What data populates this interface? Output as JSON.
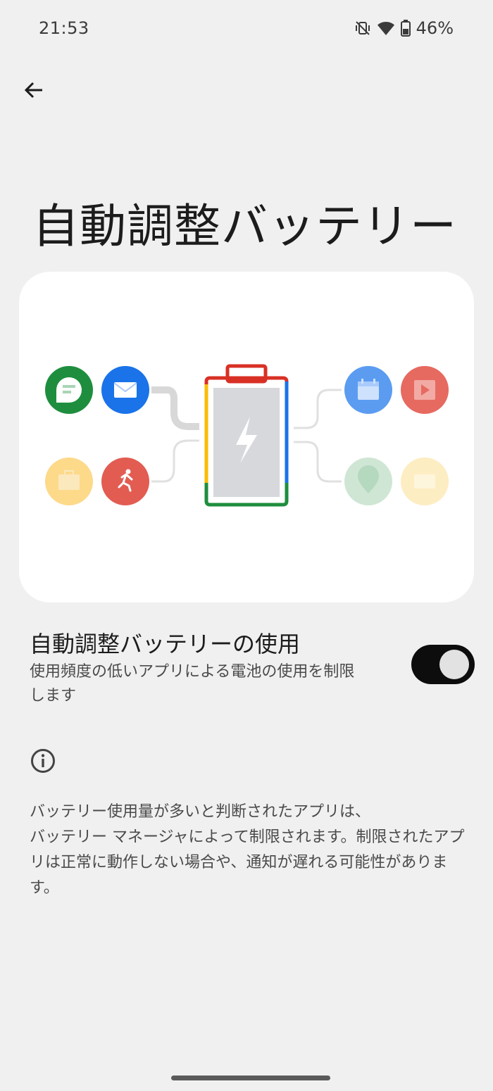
{
  "status_bar": {
    "time": "21:53",
    "battery_percent": "46%",
    "icons": [
      "vibrate-off-icon",
      "wifi-icon",
      "battery-icon"
    ]
  },
  "header": {
    "back_icon": "arrow-back-icon"
  },
  "page": {
    "title": "自動調整バッテリー"
  },
  "illustration": {
    "left_apps": [
      "message-icon",
      "mail-icon",
      "briefcase-icon",
      "running-icon"
    ],
    "right_apps": [
      "calendar-icon",
      "video-icon",
      "map-pin-icon",
      "card-icon"
    ],
    "center": "battery-charging-icon",
    "colors": {
      "green": "#1e8e3e",
      "blue": "#1a73e8",
      "yellow": "#fbbc04",
      "red": "#d93025"
    }
  },
  "setting": {
    "title": "自動調整バッテリーの使用",
    "summary": "使用頻度の低いアプリによる電池の使用を制限します",
    "enabled": true
  },
  "info": {
    "icon": "info-icon",
    "text": "バッテリー使用量が多いと判断されたアプリは、\nバッテリー マネージャによって制限されます。制限されたアプリは正常に動作しない場合や、通知が遅れる可能性があります。"
  }
}
